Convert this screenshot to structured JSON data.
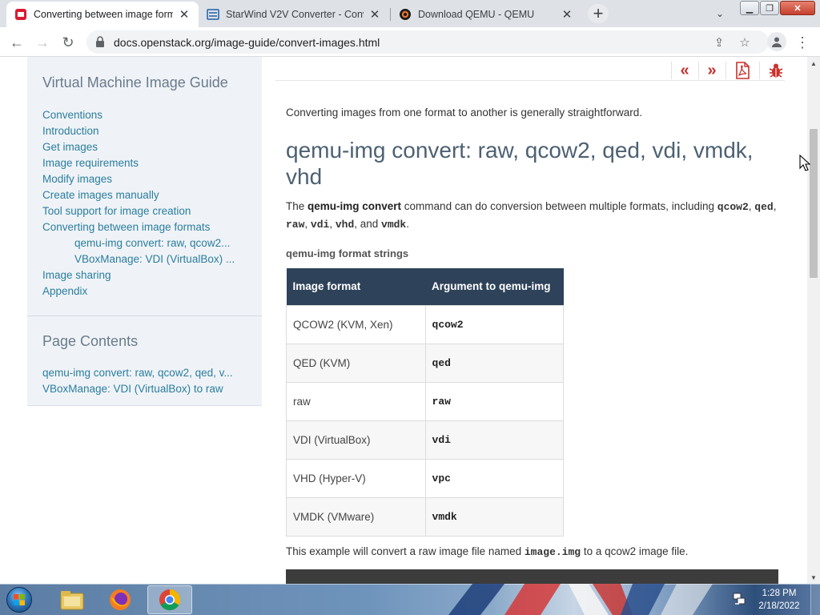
{
  "browser": {
    "tabs": [
      {
        "title": "Converting between image form",
        "active": true,
        "favicon": "openstack-icon"
      },
      {
        "title": "StarWind V2V Converter - Conve",
        "active": false,
        "favicon": "starwind-icon"
      },
      {
        "title": "Download QEMU - QEMU",
        "active": false,
        "favicon": "qemu-icon"
      }
    ],
    "url": "docs.openstack.org/image-guide/convert-images.html"
  },
  "sidebar": {
    "title": "Virtual Machine Image Guide",
    "nav": [
      {
        "label": "Conventions"
      },
      {
        "label": "Introduction"
      },
      {
        "label": "Get images"
      },
      {
        "label": "Image requirements"
      },
      {
        "label": "Modify images"
      },
      {
        "label": "Create images manually"
      },
      {
        "label": "Tool support for image creation"
      },
      {
        "label": "Converting between image formats"
      },
      {
        "label": "qemu-img convert: raw, qcow2..."
      },
      {
        "label": "VBoxManage: VDI (VirtualBox) ..."
      },
      {
        "label": "Image sharing"
      },
      {
        "label": "Appendix"
      }
    ],
    "contents_title": "Page Contents",
    "contents": [
      {
        "label": "qemu-img convert: raw, qcow2, qed, v..."
      },
      {
        "label": "VBoxManage: VDI (VirtualBox) to raw"
      }
    ]
  },
  "content": {
    "intro": "Converting images from one format to another is generally straightforward.",
    "heading": "qemu-img convert: raw, qcow2, qed, vdi, vmdk, vhd",
    "para": {
      "p1": "The ",
      "cmd": "qemu-img convert",
      "p2": " command can do conversion between multiple formats, including ",
      "f1": "qcow2",
      "s1": ", ",
      "f2": "qed",
      "s2": ", ",
      "f3": "raw",
      "s3": ", ",
      "f4": "vdi",
      "s4": ", ",
      "f5": "vhd",
      "s5": ", and ",
      "f6": "vmdk",
      "s6": "."
    },
    "table_caption": "qemu-img format strings",
    "table": {
      "headers": [
        "Image format",
        "Argument to qemu-img"
      ],
      "rows": [
        [
          "QCOW2 (KVM, Xen)",
          "qcow2"
        ],
        [
          "QED (KVM)",
          "qed"
        ],
        [
          "raw",
          "raw"
        ],
        [
          "VDI (VirtualBox)",
          "vdi"
        ],
        [
          "VHD (Hyper-V)",
          "vpc"
        ],
        [
          "VMDK (VMware)",
          "vmdk"
        ]
      ]
    },
    "example": {
      "p1": "This example will convert a raw image file named ",
      "file": "image.img",
      "p2": " to a qcow2 image file."
    }
  },
  "taskbar": {
    "apps": [
      {
        "name": "windows-explorer",
        "active": false
      },
      {
        "name": "firefox",
        "active": false
      },
      {
        "name": "chrome",
        "active": true
      }
    ],
    "time": "1:28 PM",
    "date": "2/18/2022"
  },
  "colors": {
    "accent_red": "#c9302c",
    "link": "#2b7d9e",
    "table_header": "#2e4259",
    "heading": "#4d6172"
  }
}
